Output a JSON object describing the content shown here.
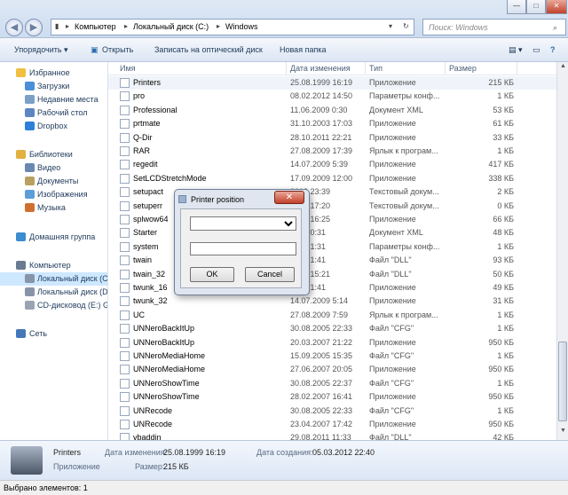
{
  "window": {
    "title_hint": ""
  },
  "address": {
    "crumbs": [
      "Компьютер",
      "Локальный диск (C:)",
      "Windows"
    ],
    "search_placeholder": "Поиск: Windows"
  },
  "toolbar": {
    "organize": "Упорядочить ▾",
    "open": "Открыть",
    "burn": "Записать на оптический диск",
    "new_folder": "Новая папка"
  },
  "nav": {
    "items": [
      {
        "label": "Избранное",
        "icon": "star-icon",
        "indent": 0
      },
      {
        "label": "Загрузки",
        "icon": "downloads-folder-icon",
        "indent": 1
      },
      {
        "label": "Недавние места",
        "icon": "recent-places-icon",
        "indent": 1
      },
      {
        "label": "Рабочий стол",
        "icon": "desktop-icon",
        "indent": 1
      },
      {
        "label": "Dropbox",
        "icon": "dropbox-icon",
        "indent": 1
      },
      {
        "label": "Библиотеки",
        "icon": "libraries-icon",
        "indent": 0
      },
      {
        "label": "Видео",
        "icon": "video-library-icon",
        "indent": 1
      },
      {
        "label": "Документы",
        "icon": "documents-library-icon",
        "indent": 1
      },
      {
        "label": "Изображения",
        "icon": "pictures-library-icon",
        "indent": 1
      },
      {
        "label": "Музыка",
        "icon": "music-library-icon",
        "indent": 1
      },
      {
        "label": "Домашняя группа",
        "icon": "homegroup-icon",
        "indent": 0
      },
      {
        "label": "Компьютер",
        "icon": "computer-icon",
        "indent": 0
      },
      {
        "label": "Локальный диск (C:)",
        "icon": "drive-icon",
        "indent": 1
      },
      {
        "label": "Локальный диск (D:)",
        "icon": "drive-icon",
        "indent": 1
      },
      {
        "label": "CD-дисковод (E:) GR",
        "icon": "cd-drive-icon",
        "indent": 1
      },
      {
        "label": "Сеть",
        "icon": "network-icon",
        "indent": 0
      }
    ]
  },
  "columns": {
    "name": "Имя",
    "date": "Дата изменения",
    "type": "Тип",
    "size": "Размер"
  },
  "files": [
    {
      "name": "Printers",
      "date": "25.08.1999 16:19",
      "type": "Приложение",
      "size": "215 КБ"
    },
    {
      "name": "pro",
      "date": "08.02.2012 14:50",
      "type": "Параметры конф...",
      "size": "1 КБ"
    },
    {
      "name": "Professional",
      "date": "11.06.2009 0:30",
      "type": "Документ XML",
      "size": "53 КБ"
    },
    {
      "name": "prtmate",
      "date": "31.10.2003 17:03",
      "type": "Приложение",
      "size": "61 КБ"
    },
    {
      "name": "Q-Dir",
      "date": "28.10.2011 22:21",
      "type": "Приложение",
      "size": "33 КБ"
    },
    {
      "name": "RAR",
      "date": "27.08.2009 17:39",
      "type": "Ярлык к програм...",
      "size": "1 КБ"
    },
    {
      "name": "regedit",
      "date": "14.07.2009 5:39",
      "type": "Приложение",
      "size": "417 КБ"
    },
    {
      "name": "SetLCDStretchMode",
      "date": "17.09.2009 12:00",
      "type": "Приложение",
      "size": "338 КБ"
    },
    {
      "name": "setupact",
      "date": "2012 23:39",
      "type": "Текстовый докум...",
      "size": "2 КБ"
    },
    {
      "name": "setuperr",
      "date": "2012 17:20",
      "type": "Текстовый докум...",
      "size": "0 КБ"
    },
    {
      "name": "splwow64",
      "date": "2010 16:25",
      "type": "Приложение",
      "size": "66 КБ"
    },
    {
      "name": "Starter",
      "date": "2009 0:31",
      "type": "Документ XML",
      "size": "48 КБ"
    },
    {
      "name": "system",
      "date": "2009 1:31",
      "type": "Параметры конф...",
      "size": "1 КБ"
    },
    {
      "name": "twain",
      "date": "2009 1:41",
      "type": "Файл \"DLL\"",
      "size": "93 КБ"
    },
    {
      "name": "twain_32",
      "date": "2010 15:21",
      "type": "Файл \"DLL\"",
      "size": "50 КБ"
    },
    {
      "name": "twunk_16",
      "date": "2009 1:41",
      "type": "Приложение",
      "size": "49 КБ"
    },
    {
      "name": "twunk_32",
      "date": "14.07.2009 5:14",
      "type": "Приложение",
      "size": "31 КБ"
    },
    {
      "name": "UC",
      "date": "27.08.2009 7:59",
      "type": "Ярлык к програм...",
      "size": "1 КБ"
    },
    {
      "name": "UNNeroBackItUp",
      "date": "30.08.2005 22:33",
      "type": "Файл \"CFG\"",
      "size": "1 КБ"
    },
    {
      "name": "UNNeroBackItUp",
      "date": "20.03.2007 21:22",
      "type": "Приложение",
      "size": "950 КБ"
    },
    {
      "name": "UNNeroMediaHome",
      "date": "15.09.2005 15:35",
      "type": "Файл \"CFG\"",
      "size": "1 КБ"
    },
    {
      "name": "UNNeroMediaHome",
      "date": "27.06.2007 20:05",
      "type": "Приложение",
      "size": "950 КБ"
    },
    {
      "name": "UNNeroShowTime",
      "date": "30.08.2005 22:37",
      "type": "Файл \"CFG\"",
      "size": "1 КБ"
    },
    {
      "name": "UNNeroShowTime",
      "date": "28.02.2007 16:41",
      "type": "Приложение",
      "size": "950 КБ"
    },
    {
      "name": "UNRecode",
      "date": "30.08.2005 22:33",
      "type": "Файл \"CFG\"",
      "size": "1 КБ"
    },
    {
      "name": "UNRecode",
      "date": "23.04.2007 17:42",
      "type": "Приложение",
      "size": "950 КБ"
    },
    {
      "name": "vbaddin",
      "date": "29.08.2011 11:33",
      "type": "Файл \"DLL\"",
      "size": "42 КБ"
    }
  ],
  "details": {
    "file_name": "Printers",
    "file_type": "Приложение",
    "modified_label": "Дата изменения:",
    "modified_value": "25.08.1999 16:19",
    "created_label": "Дата создания:",
    "created_value": "05.03.2012 22:40",
    "size_label": "Размер:",
    "size_value": "215 КБ"
  },
  "status": {
    "selected": "Выбрано элементов: 1"
  },
  "dialog": {
    "title": "Printer position",
    "close": "✕",
    "select_value": "",
    "input_value": "",
    "ok": "OK",
    "cancel": "Cancel"
  },
  "colors": {
    "accent": "#1e395b",
    "selection": "#cde8ff",
    "close_button": "#c2412b"
  }
}
